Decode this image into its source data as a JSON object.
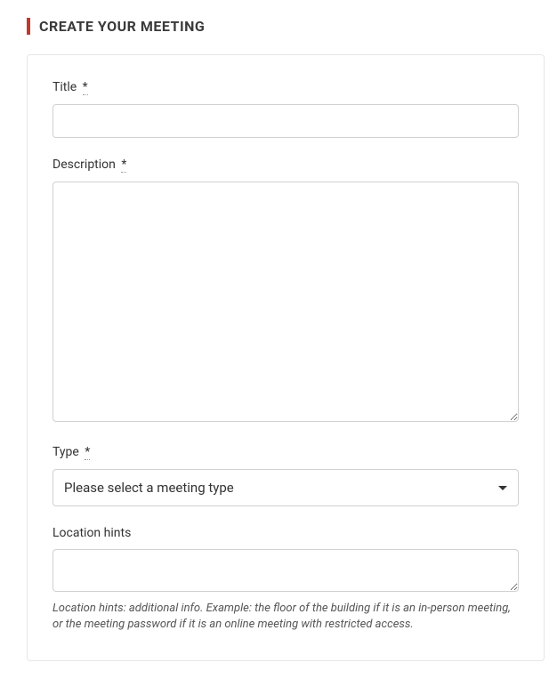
{
  "header": {
    "title": "CREATE YOUR MEETING"
  },
  "form": {
    "title": {
      "label": "Title",
      "required_mark": "*",
      "value": ""
    },
    "description": {
      "label": "Description",
      "required_mark": "*",
      "value": ""
    },
    "type": {
      "label": "Type",
      "required_mark": "*",
      "selected": "Please select a meeting type"
    },
    "location_hints": {
      "label": "Location hints",
      "value": "",
      "help": "Location hints: additional info. Example: the floor of the building if it is an in-person meeting, or the meeting password if it is an online meeting with restricted access."
    }
  }
}
